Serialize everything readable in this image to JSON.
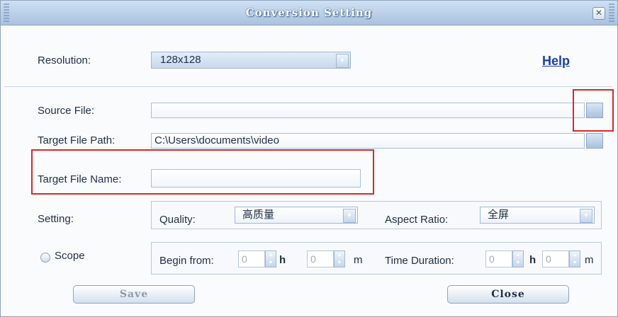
{
  "window": {
    "title": "Conversion Setting",
    "close_glyph": "✕"
  },
  "resolution": {
    "label": "Resolution:",
    "value": "128x128"
  },
  "help_link": "Help",
  "source_file": {
    "label": "Source File:",
    "value": ""
  },
  "target_path": {
    "label": "Target File Path:",
    "value": "C:\\Users\\documents\\video"
  },
  "target_name": {
    "label": "Target File Name:",
    "value": ""
  },
  "setting": {
    "label": "Setting:",
    "quality_label": "Quality:",
    "quality_value": "高质量",
    "aspect_label": "Aspect Ratio:",
    "aspect_value": "全屏"
  },
  "scope": {
    "label": "Scope",
    "checked": false,
    "begin_label": "Begin from:",
    "begin_h": "0",
    "h_unit": "h",
    "begin_m": "0",
    "m_unit": "m",
    "duration_label": "Time Duration:",
    "duration_h": "0",
    "duration_m": "0"
  },
  "buttons": {
    "save": "Save",
    "close": "Close"
  },
  "colors": {
    "highlight": "#d8282a",
    "link": "#1a3fa8",
    "title_text": "#ffffff"
  },
  "icons": [
    "close-icon",
    "dropdown-arrow-icon",
    "spin-up-icon",
    "spin-down-icon",
    "browse-icon"
  ]
}
